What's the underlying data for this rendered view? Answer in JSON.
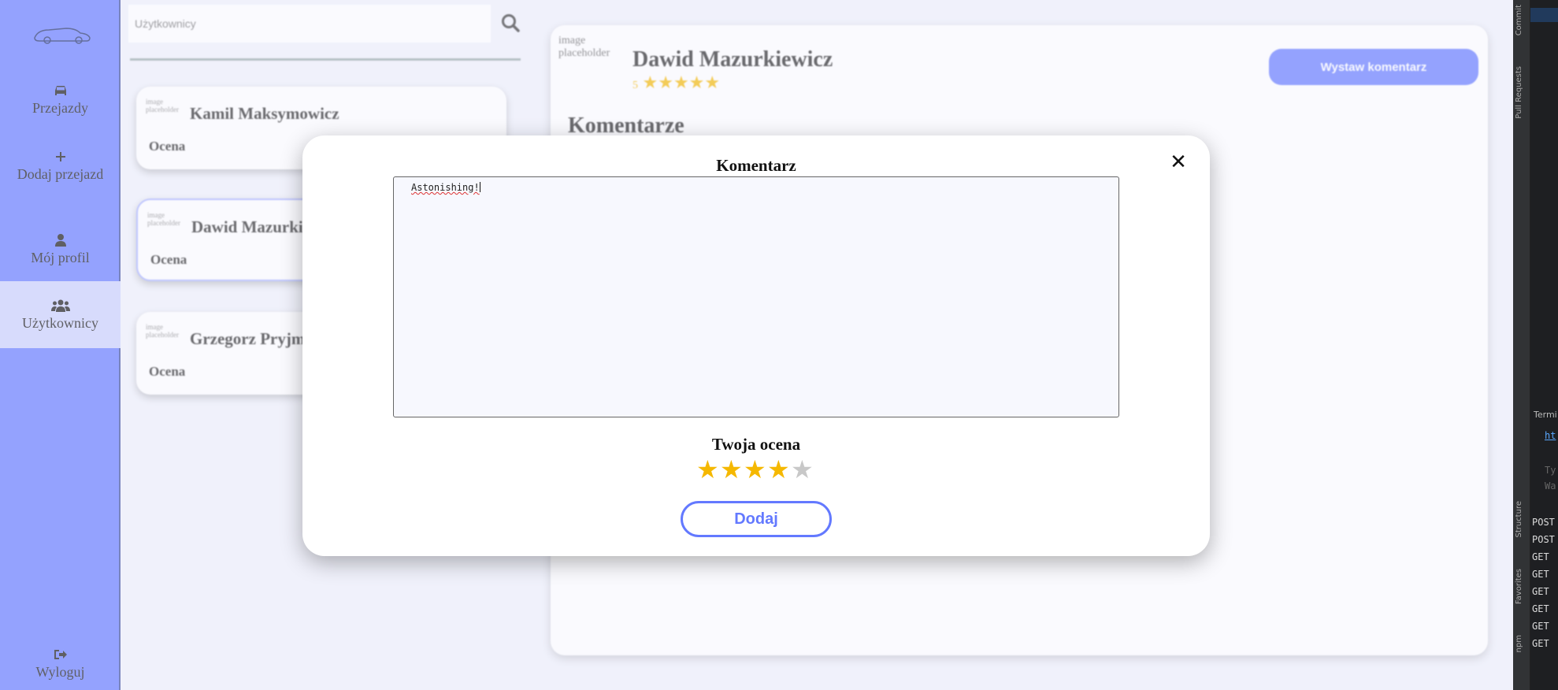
{
  "sidebar": {
    "items": [
      {
        "label": "Przejazdy",
        "icon": "car-icon"
      },
      {
        "label": "Dodaj przejazd",
        "icon": "plus-icon"
      },
      {
        "label": "Mój profil",
        "icon": "user-icon"
      },
      {
        "label": "Użytkownicy",
        "icon": "users-icon",
        "active": true
      }
    ],
    "logout": "Wyloguj",
    "accent": "#6379ff"
  },
  "search": {
    "placeholder": "Użytkownicy"
  },
  "users": [
    {
      "name": "Kamil Maksymowicz",
      "rating_label": "Ocena",
      "avatar_alt": "image placeholder"
    },
    {
      "name": "Dawid Mazurkiewicz",
      "rating_label": "Ocena",
      "avatar_alt": "image placeholder"
    },
    {
      "name": "Grzegorz Pryjma",
      "rating_label": "Ocena",
      "avatar_alt": "image placeholder"
    }
  ],
  "profile": {
    "avatar_alt": "image placeholder",
    "name": "Dawid Mazurkiewicz",
    "rating_num": "5",
    "stars": "★★★★★",
    "comment_button": "Wystaw komentarz",
    "comments_heading": "Komentarze"
  },
  "modal": {
    "title": "Komentarz",
    "comment_text": "Astonishing!",
    "rating_label": "Twoja ocena",
    "rating": 4,
    "max_rating": 5,
    "submit": "Dodaj",
    "star_on_color": "#f5b800",
    "star_off_color": "#c8c8c8"
  },
  "ide": {
    "labels": {
      "commit": "Commit",
      "pull_requests": "Pull Requests",
      "structure": "Structure",
      "favorites": "Favorites",
      "npm": "npm"
    },
    "terminal": "Termi",
    "link": "ht",
    "dim_lines": [
      "Ty",
      "Wa"
    ],
    "log": [
      "POST",
      "POST",
      "GET",
      "GET",
      "GET",
      "GET",
      "GET",
      "GET"
    ]
  }
}
